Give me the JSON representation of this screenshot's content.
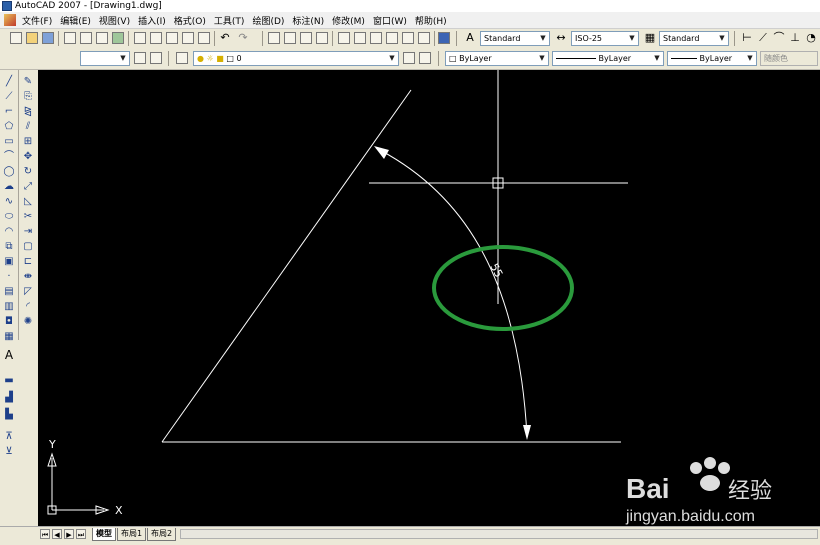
{
  "window": {
    "title": "AutoCAD 2007 - [Drawing1.dwg]"
  },
  "menu": [
    "文件(F)",
    "编辑(E)",
    "视图(V)",
    "插入(I)",
    "格式(O)",
    "工具(T)",
    "绘图(D)",
    "标注(N)",
    "修改(M)",
    "窗口(W)",
    "帮助(H)"
  ],
  "styles_toolbar": {
    "text_style": "Standard",
    "dim_style": "ISO-25",
    "table_style": "Standard"
  },
  "layers_toolbar": {
    "layer": "0",
    "color": "ByLayer",
    "linetype": "ByLayer",
    "lineweight": "ByLayer",
    "plotstyle": "随颜色"
  },
  "canvas": {
    "dimension_text": "55",
    "ucs_y_label": "Y",
    "ucs_x_label": "X"
  },
  "tabs": [
    "模型",
    "布局1",
    "布局2"
  ],
  "watermark": {
    "brand": "Bai",
    "brand_suffix": "经验",
    "url": "jingyan.baidu.com"
  },
  "colors": {
    "canvas_bg": "#000000",
    "lines": "#ffffff",
    "highlight_ellipse": "#2a9a3c"
  }
}
